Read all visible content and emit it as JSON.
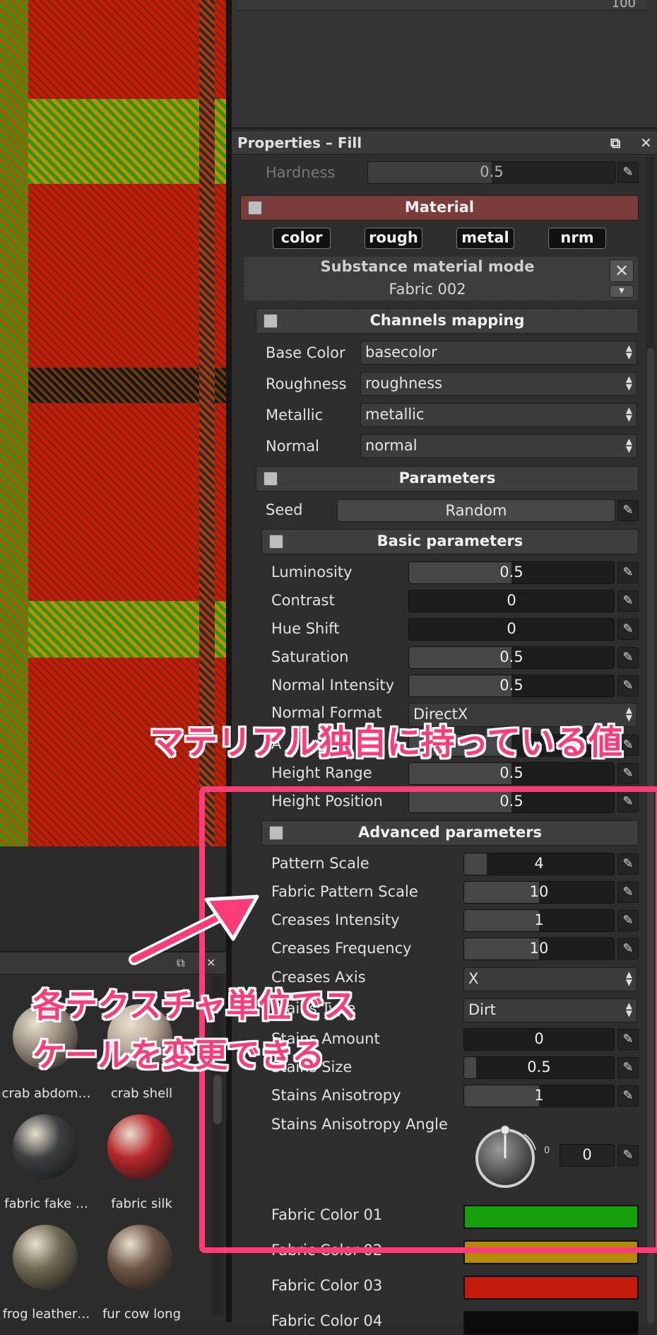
{
  "top_strip": {
    "value": "100"
  },
  "panel": {
    "title": "Properties – Fill",
    "hardness": {
      "label": "Hardness",
      "value": "0.5"
    },
    "material": {
      "title": "Material",
      "channels": [
        "color",
        "rough",
        "metal",
        "nrm"
      ],
      "mode_title": "Substance material mode",
      "mode_value": "Fabric 002"
    },
    "channels_mapping": {
      "title": "Channels mapping",
      "rows": [
        {
          "label": "Base Color",
          "value": "basecolor"
        },
        {
          "label": "Roughness",
          "value": "roughness"
        },
        {
          "label": "Metallic",
          "value": "metallic"
        },
        {
          "label": "Normal",
          "value": "normal"
        }
      ]
    },
    "parameters": {
      "title": "Parameters",
      "seed_label": "Seed",
      "seed_button": "Random"
    },
    "basic": {
      "title": "Basic parameters",
      "rows": [
        {
          "label": "Luminosity",
          "value": "0.5",
          "fraction": 0.5
        },
        {
          "label": "Contrast",
          "value": "0",
          "fraction": 0
        },
        {
          "label": "Hue Shift",
          "value": "0",
          "fraction": 0
        },
        {
          "label": "Saturation",
          "value": "0.5",
          "fraction": 0.5
        },
        {
          "label": "Normal Intensity",
          "value": "0.5",
          "fraction": 0.5
        }
      ],
      "normal_format": {
        "label": "Normal Format",
        "value": "DirectX"
      },
      "ao_label": "A",
      "rows2": [
        {
          "label": "Height Range",
          "value": "0.5",
          "fraction": 0.5
        },
        {
          "label": "Height Position",
          "value": "0.5",
          "fraction": 0.5
        }
      ]
    },
    "advanced": {
      "title": "Advanced parameters",
      "rows": [
        {
          "label": "Pattern Scale",
          "value": "4",
          "fraction": 0.15
        },
        {
          "label": "Fabric Pattern Scale",
          "value": "10",
          "fraction": 0.5
        },
        {
          "label": "Creases Intensity",
          "value": "1",
          "fraction": 0.5
        },
        {
          "label": "Creases Frequency",
          "value": "10",
          "fraction": 0.5
        }
      ],
      "creases_axis": {
        "label": "Creases Axis",
        "value": "X"
      },
      "stains_type": {
        "label": "Stains Type",
        "value": "Dirt"
      },
      "rows2": [
        {
          "label": "Stains Amount",
          "value": "0",
          "fraction": 0
        },
        {
          "label": "Stains Size",
          "value": "0.5",
          "fraction": 0.08
        },
        {
          "label": "Stains Anisotropy",
          "value": "1",
          "fraction": 0.5
        }
      ],
      "angle": {
        "label": "Stains Anisotropy Angle",
        "value": "0",
        "dial_zero": "0"
      },
      "colors": [
        {
          "label": "Fabric Color 01",
          "color": "#16a00c"
        },
        {
          "label": "Fabric Color 02",
          "color": "#b38a06"
        },
        {
          "label": "Fabric Color 03",
          "color": "#c21b0b"
        },
        {
          "label": "Fabric Color 04",
          "color": "#0a0a0a"
        }
      ]
    }
  },
  "shelf": {
    "items": [
      {
        "label": "crab abdom…",
        "color": "#9a8f80"
      },
      {
        "label": "crab shell",
        "color": "#b8a898"
      },
      {
        "label": "fabric fake …",
        "color": "#3c3f40"
      },
      {
        "label": "fabric silk",
        "color": "#b8262a"
      },
      {
        "label": "frog leather…",
        "color": "#6f6a52"
      },
      {
        "label": "fur cow long",
        "color": "#6e5646"
      }
    ]
  },
  "annotations": {
    "top": "マテリアル独自に持っている値",
    "bottom_line1": "各テクスチャ単位でス",
    "bottom_line2": "ケールを変更できる"
  },
  "colors": {
    "accent_pink": "#ff3c78",
    "material_header": "#7a3b3b"
  }
}
